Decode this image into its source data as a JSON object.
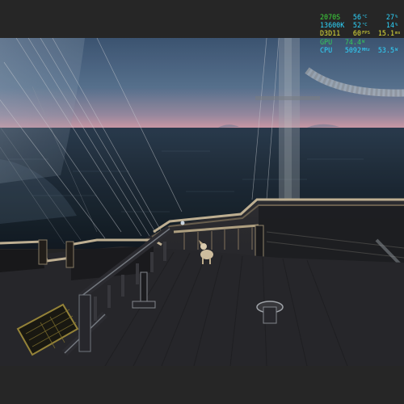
{
  "overlay": {
    "rows": [
      {
        "label": "2070S",
        "value1": "56",
        "unit1": "°C",
        "value2": "27",
        "unit2": "%",
        "kind": "gpu"
      },
      {
        "label": "13600K",
        "value1": "52",
        "unit1": "°C",
        "value2": "14",
        "unit2": "%",
        "kind": "cpu"
      },
      {
        "label": "D3D11",
        "value1": "60",
        "unit1": "FPS",
        "value2": "15.1",
        "unit2": "ms",
        "kind": "api"
      },
      {
        "label": "GPU",
        "value1": "74.4",
        "unit1": "W",
        "value2": "",
        "unit2": "",
        "kind": "vpu"
      },
      {
        "label": "CPU",
        "value1": "5092",
        "unit1": "MHz",
        "value2": "53.5",
        "unit2": "W",
        "kind": "cpuf"
      }
    ]
  },
  "scene": {
    "sky_color": "#4e6786",
    "horizon_color": "#c79aa6",
    "sea_color": "#23303d",
    "deck_color": "#2b2b2f",
    "trim_color": "#c9b99a"
  }
}
